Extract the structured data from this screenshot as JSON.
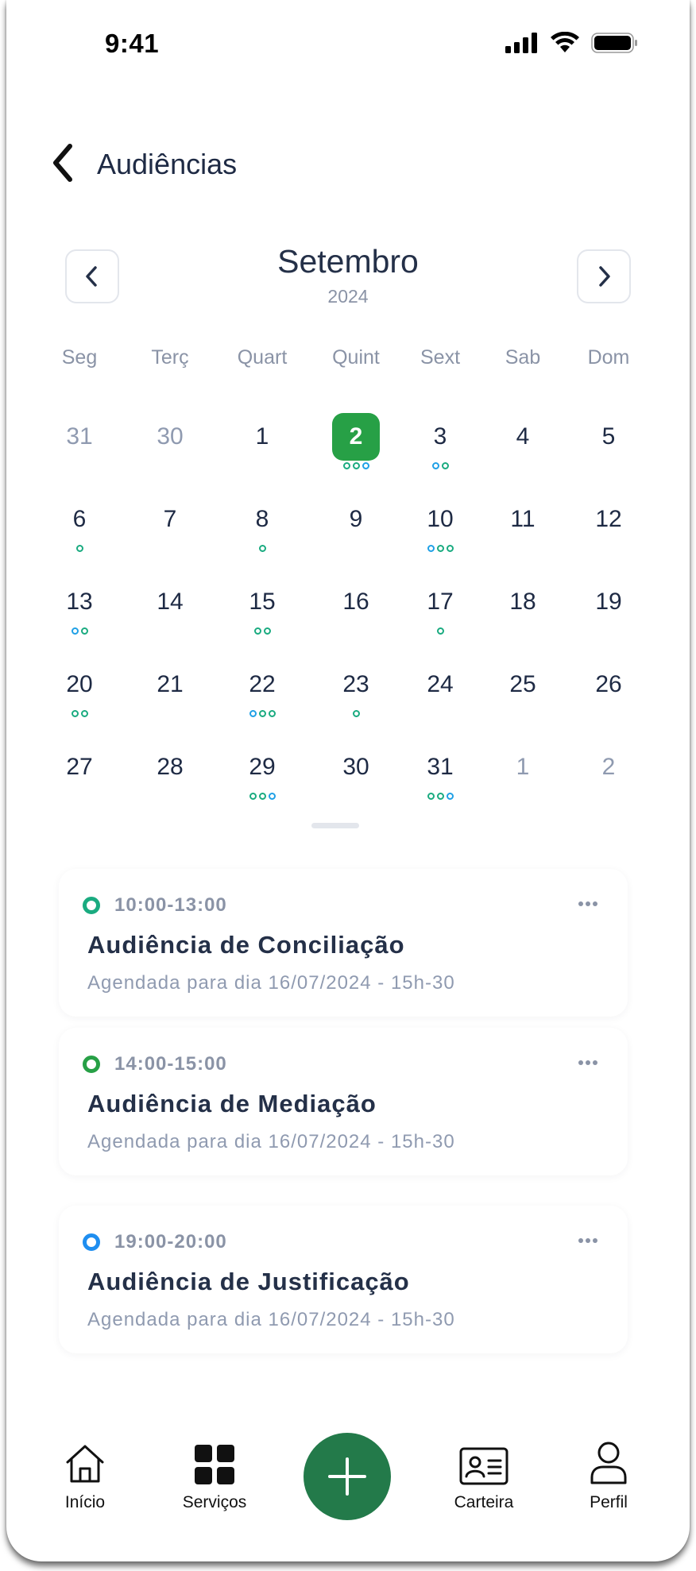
{
  "status_bar": {
    "time": "9:41"
  },
  "header": {
    "title": "Audiências"
  },
  "calendar": {
    "month": "Setembro",
    "year": "2024",
    "weekdays": [
      "Seg",
      "Terç",
      "Quart",
      "Quint",
      "Sext",
      "Sab",
      "Dom"
    ],
    "weeks": [
      [
        {
          "d": "31",
          "muted": true,
          "dots": []
        },
        {
          "d": "30",
          "muted": true,
          "dots": []
        },
        {
          "d": "1",
          "dots": []
        },
        {
          "d": "2",
          "selected": true,
          "dots": [
            "g",
            "g",
            "b"
          ]
        },
        {
          "d": "3",
          "dots": [
            "b",
            "g"
          ]
        },
        {
          "d": "4",
          "dots": []
        },
        {
          "d": "5",
          "dots": []
        }
      ],
      [
        {
          "d": "6",
          "dots": [
            "g"
          ]
        },
        {
          "d": "7",
          "dots": []
        },
        {
          "d": "8",
          "dots": [
            "g"
          ]
        },
        {
          "d": "9",
          "dots": []
        },
        {
          "d": "10",
          "dots": [
            "b",
            "g",
            "g"
          ]
        },
        {
          "d": "11",
          "dots": []
        },
        {
          "d": "12",
          "dots": []
        }
      ],
      [
        {
          "d": "13",
          "dots": [
            "b",
            "g"
          ]
        },
        {
          "d": "14",
          "dots": []
        },
        {
          "d": "15",
          "dots": [
            "g",
            "g"
          ]
        },
        {
          "d": "16",
          "dots": []
        },
        {
          "d": "17",
          "dots": [
            "g"
          ]
        },
        {
          "d": "18",
          "dots": []
        },
        {
          "d": "19",
          "dots": []
        }
      ],
      [
        {
          "d": "20",
          "dots": [
            "g",
            "g"
          ]
        },
        {
          "d": "21",
          "dots": []
        },
        {
          "d": "22",
          "dots": [
            "b",
            "g",
            "g"
          ]
        },
        {
          "d": "23",
          "dots": [
            "g"
          ]
        },
        {
          "d": "24",
          "dots": []
        },
        {
          "d": "25",
          "dots": []
        },
        {
          "d": "26",
          "dots": []
        }
      ],
      [
        {
          "d": "27",
          "dots": []
        },
        {
          "d": "28",
          "dots": []
        },
        {
          "d": "29",
          "dots": [
            "g",
            "g",
            "b"
          ]
        },
        {
          "d": "30",
          "dots": []
        },
        {
          "d": "31",
          "dots": [
            "g",
            "g",
            "b"
          ]
        },
        {
          "d": "1",
          "muted": true,
          "dots": []
        },
        {
          "d": "2",
          "muted": true,
          "dots": []
        }
      ]
    ],
    "dot_colors": {
      "g": "#1aab80",
      "b": "#1fa0e6"
    },
    "selected_color": "#27a046"
  },
  "events": [
    {
      "time": "10:00-13:00",
      "title": "Audiência de Conciliação",
      "subtitle": "Agendada para dia 16/07/2024 - 15h-30",
      "color": "#1aab80"
    },
    {
      "time": "14:00-15:00",
      "title": "Audiência de Mediação",
      "subtitle": "Agendada para dia 16/07/2024 - 15h-30",
      "color": "#27a046"
    },
    {
      "time": "19:00-20:00",
      "title": "Audiência de Justificação",
      "subtitle": "Agendada para dia 16/07/2024 - 15h-30",
      "color": "#1f8ef0"
    }
  ],
  "bottom_nav": {
    "home": "Início",
    "services": "Serviços",
    "wallet": "Carteira",
    "profile": "Perfil"
  },
  "colors": {
    "fab": "#237a4a"
  }
}
